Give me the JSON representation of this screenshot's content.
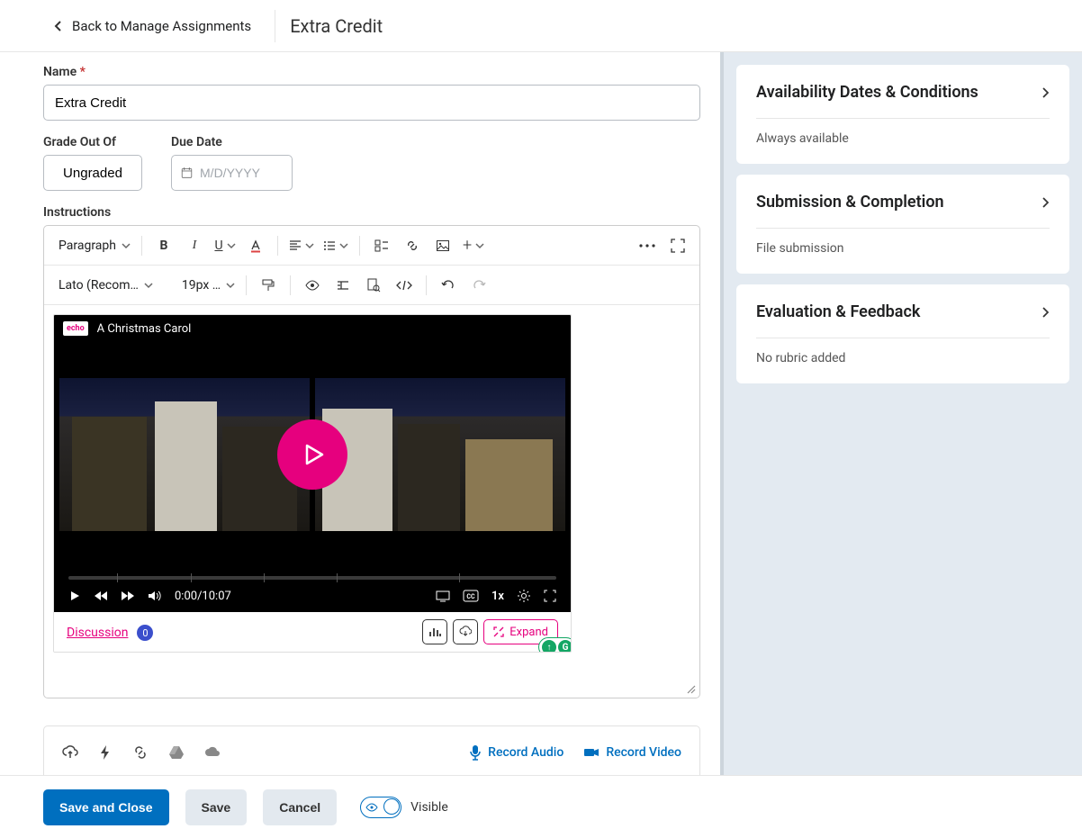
{
  "header": {
    "back_label": "Back to Manage Assignments",
    "page_title": "Extra Credit"
  },
  "form": {
    "name_label": "Name",
    "name_req": "*",
    "name_value": "Extra Credit",
    "grade_label": "Grade Out Of",
    "grade_value": "Ungraded",
    "due_label": "Due Date",
    "due_placeholder": "M/D/YYYY",
    "due_value": "",
    "instructions_label": "Instructions"
  },
  "editor": {
    "style_select": "Paragraph",
    "font_select": "Lato (Recom…",
    "size_select": "19px …"
  },
  "video": {
    "title": "A Christmas Carol",
    "logo_text": "echo",
    "time": "0:00/10:07",
    "speed": "1x",
    "discussion_label": "Discussion",
    "discussion_count": "0",
    "expand_label": "Expand"
  },
  "attach": {
    "record_audio": "Record Audio",
    "record_video": "Record Video"
  },
  "panels": {
    "avail_title": "Availability Dates & Conditions",
    "avail_sub": "Always available",
    "sub_title": "Submission & Completion",
    "sub_sub": "File submission",
    "eval_title": "Evaluation & Feedback",
    "eval_sub": "No rubric added"
  },
  "footer": {
    "save_close": "Save and Close",
    "save": "Save",
    "cancel": "Cancel",
    "visible": "Visible"
  }
}
